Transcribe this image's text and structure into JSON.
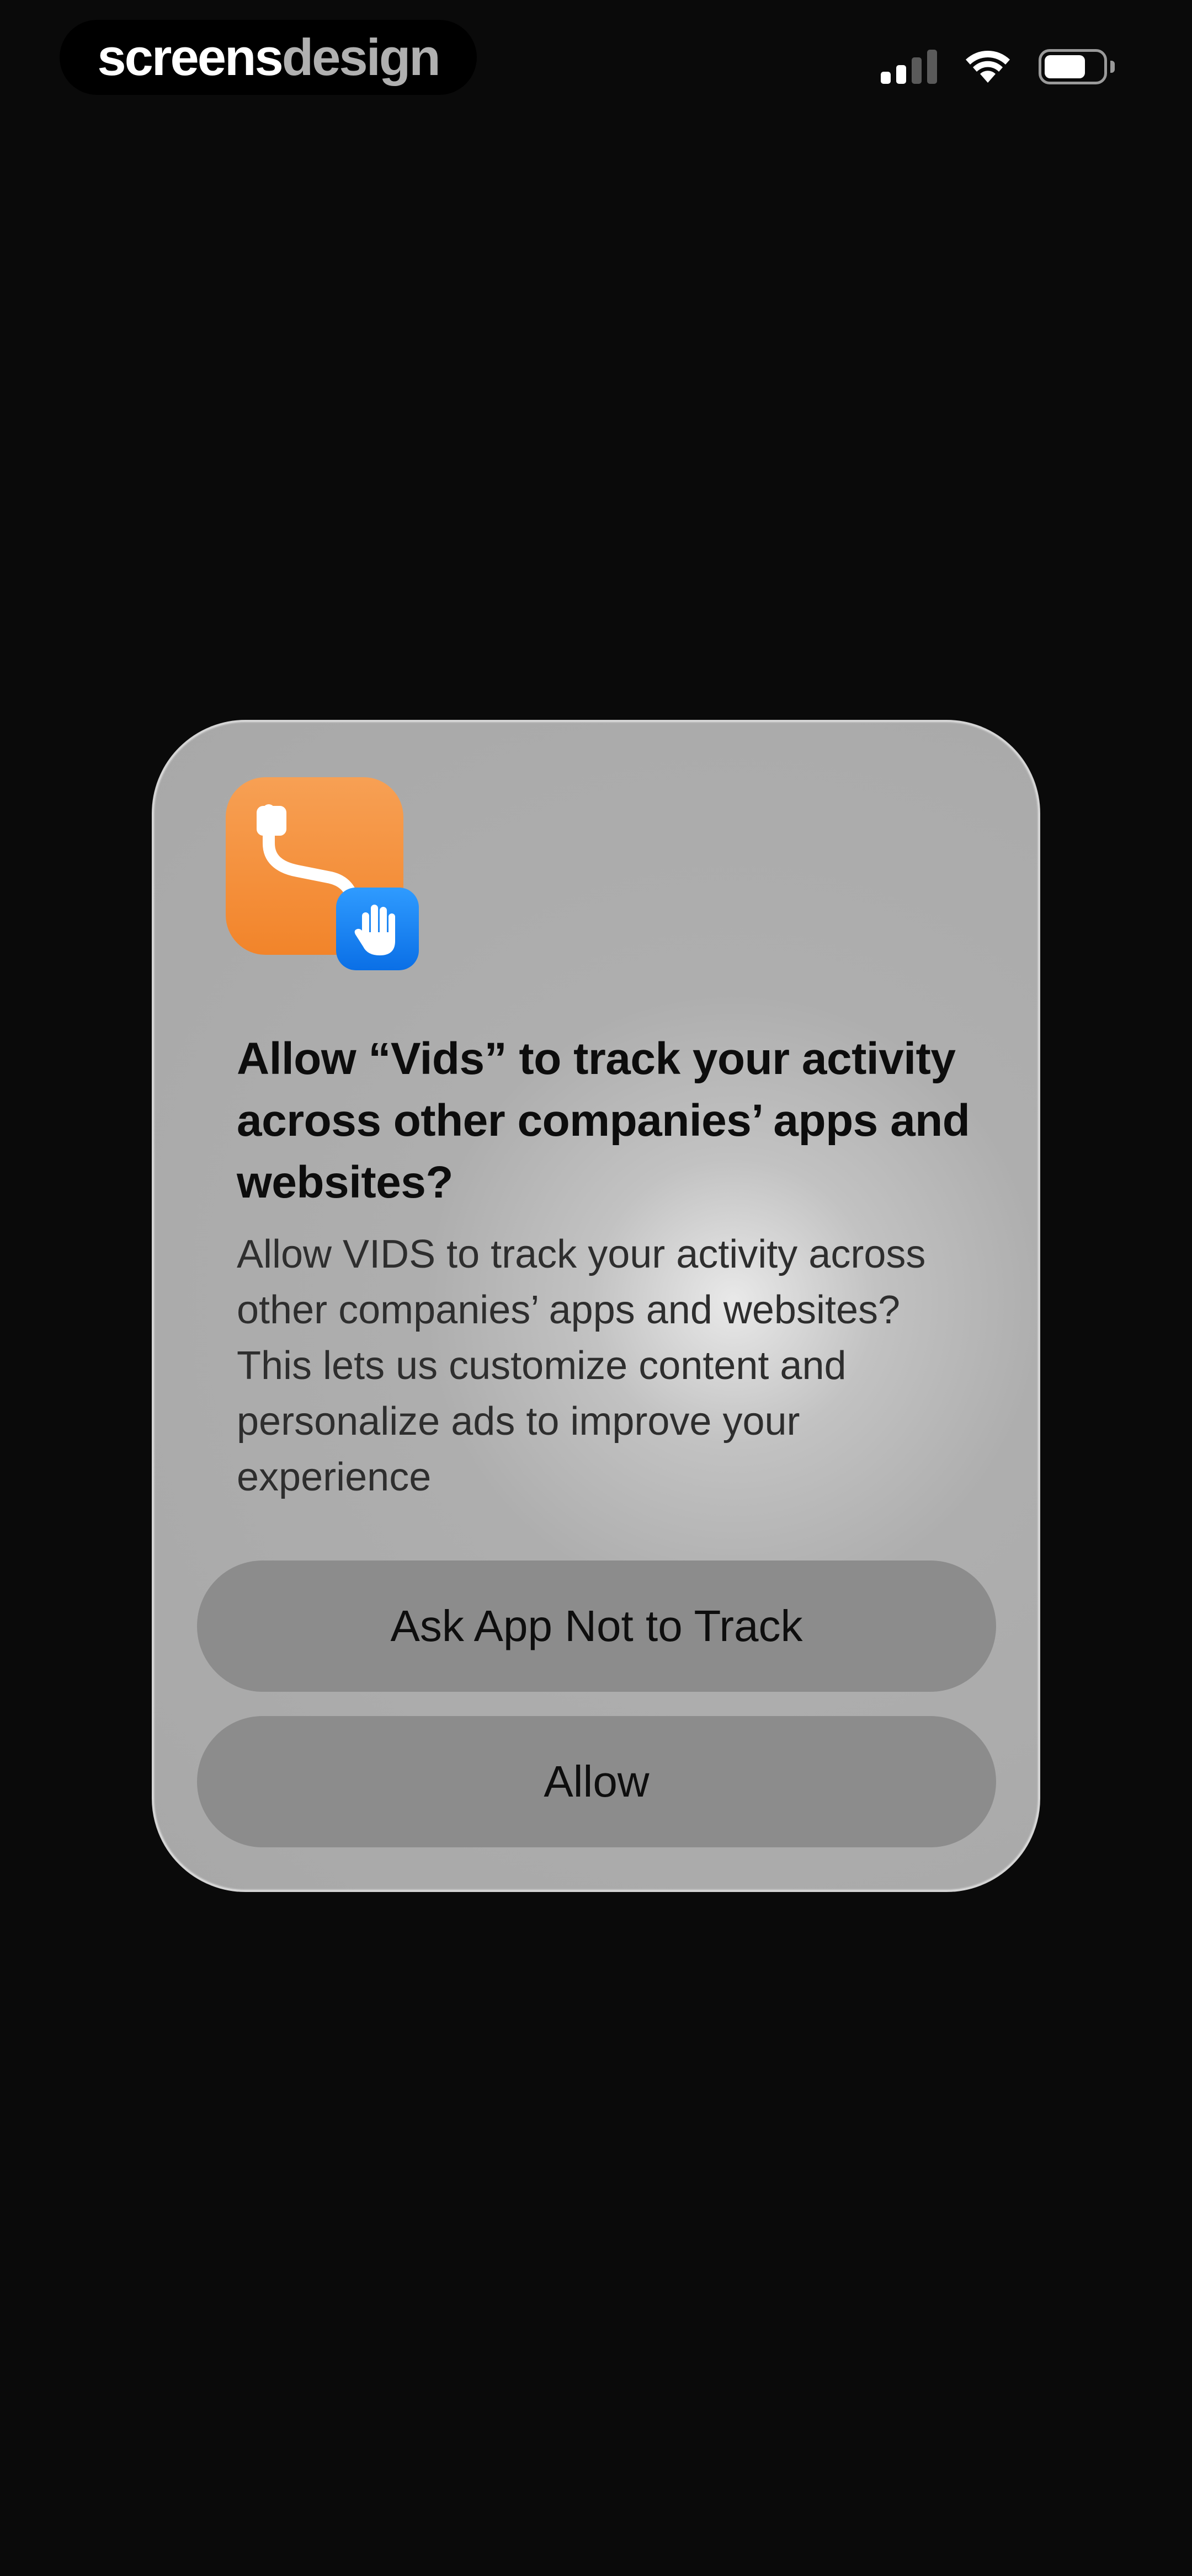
{
  "status_bar": {
    "brand_primary": "screens",
    "brand_secondary": "design",
    "icons": [
      "signal-icon",
      "wifi-icon",
      "battery-icon"
    ]
  },
  "dialog": {
    "title": "Allow “Vids” to track your activity across other companies’ apps and websites?",
    "message": "Allow VIDS to track your activity across other companies’ apps and websites? This lets us customize content and personalize ads to improve your experience",
    "buttons": {
      "deny_label": "Ask App Not to Track",
      "allow_label": "Allow"
    },
    "icons": [
      "app-icon",
      "tracking-hand-icon"
    ]
  },
  "colors": {
    "background": "#0a0a0a",
    "app_icon_orange": "#f2842a",
    "badge_blue": "#0a6fe6",
    "button_gray": "#8c8c8c"
  }
}
